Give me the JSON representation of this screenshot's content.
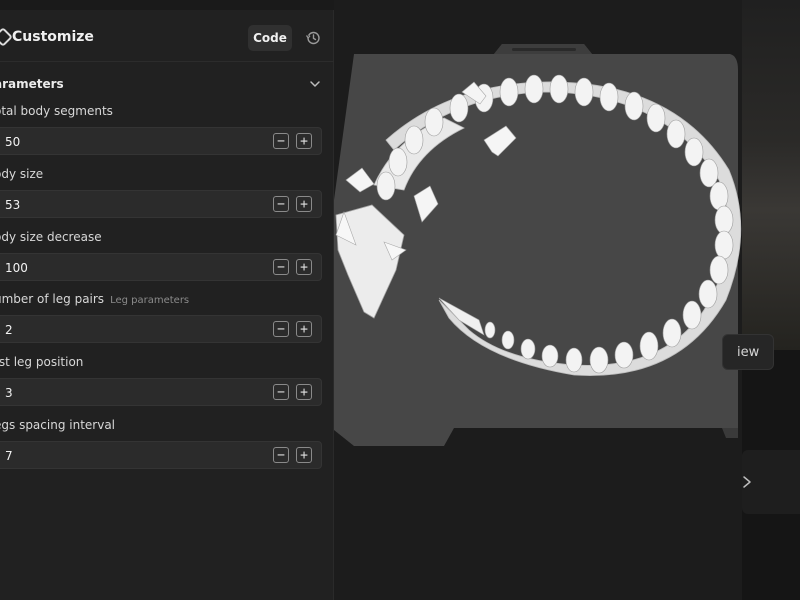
{
  "header": {
    "title": "Customize",
    "code_label": "Code"
  },
  "parameters": {
    "section_title": "arameters",
    "items": [
      {
        "label": "otal body segments",
        "value": "50",
        "sublabel": ""
      },
      {
        "label": "ody size",
        "value": "53",
        "sublabel": ""
      },
      {
        "label": "ody size decrease",
        "value": "100",
        "sublabel": ""
      },
      {
        "label": "umber of leg pairs",
        "value": "2",
        "sublabel": "Leg parameters"
      },
      {
        "label": "rst leg position",
        "value": "3",
        "sublabel": ""
      },
      {
        "label": "egs spacing interval",
        "value": "7",
        "sublabel": ""
      }
    ]
  },
  "viewer": {
    "view_label": "iew"
  },
  "icons": {
    "customize": "customize-icon",
    "history": "history-icon",
    "chevron": "chevron-down-icon",
    "minus": "minus-icon",
    "plus": "plus-icon",
    "next": "chevron-right-icon"
  },
  "colors": {
    "panel_bg": "#212121",
    "field_bg": "#2b2b2b",
    "plate": "#474747",
    "model": "#e9e9e9"
  }
}
